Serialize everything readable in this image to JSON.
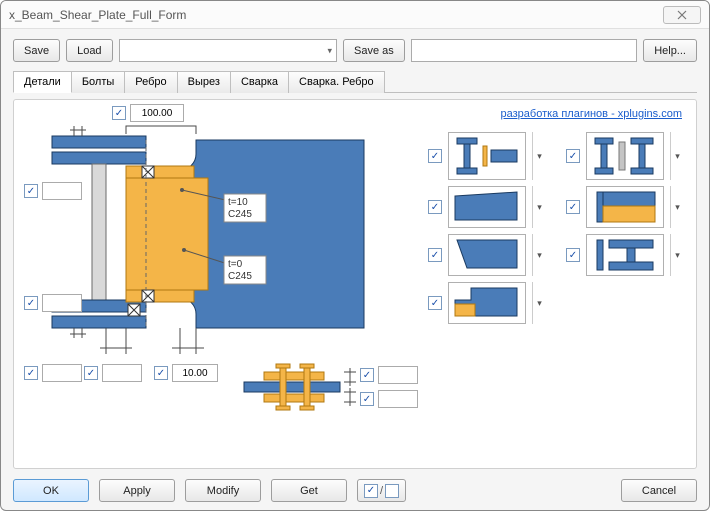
{
  "window": {
    "title": "x_Beam_Shear_Plate_Full_Form"
  },
  "toolbar": {
    "save": "Save",
    "load": "Load",
    "saveas": "Save as",
    "help": "Help..."
  },
  "tabs": [
    "Детали",
    "Болты",
    "Ребро",
    "Вырез",
    "Сварка",
    "Сварка. Ребро"
  ],
  "active_tab": 0,
  "link_text": "разработка плагинов - xplugins.com",
  "fields": {
    "top_dim": "100.00",
    "bottom_dim": "10.00",
    "plate_main": {
      "t": "t=10",
      "mat": "C245"
    },
    "plate_secondary": {
      "t": "t=0",
      "mat": "C245"
    }
  },
  "buttons": {
    "ok": "OK",
    "apply": "Apply",
    "modify": "Modify",
    "get": "Get",
    "cancel": "Cancel"
  },
  "checkboxes": {
    "top_dim": true,
    "left1": true,
    "left2": true,
    "left3": true,
    "bottom1": true,
    "bottom2": true,
    "r1": true,
    "r2": true,
    "r3": true,
    "r4": true,
    "r5": true,
    "r6": true,
    "th1": true,
    "th2": true,
    "th3": true,
    "th4": true,
    "th5": true,
    "th6": true,
    "th7": true
  },
  "thumb_icons": [
    "ibeam-column",
    "ibeam-side",
    "beam-cut-top",
    "beam-haunch",
    "beam-cut-angle",
    "ibeam-side-2",
    "beam-notch"
  ]
}
